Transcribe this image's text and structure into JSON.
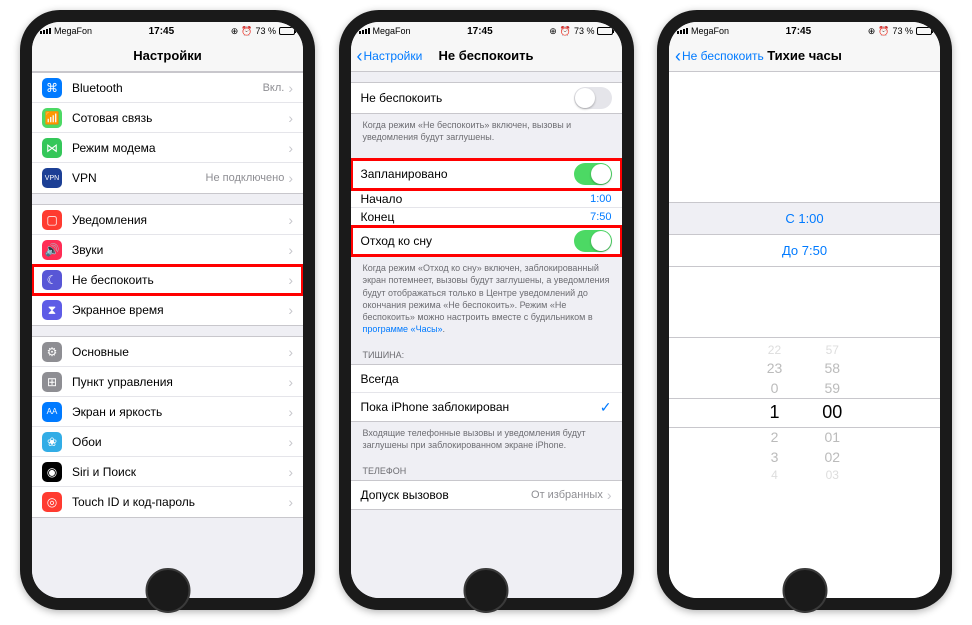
{
  "status": {
    "carrier": "MegaFon",
    "time": "17:45",
    "battery_pct": "73 %"
  },
  "phone1": {
    "title": "Настройки",
    "rows": {
      "bluetooth": "Bluetooth",
      "bluetooth_val": "Вкл.",
      "cellular": "Сотовая связь",
      "hotspot": "Режим модема",
      "vpn": "VPN",
      "vpn_val": "Не подключено",
      "notifications": "Уведомления",
      "sounds": "Звуки",
      "dnd": "Не беспокоить",
      "screentime": "Экранное время",
      "general": "Основные",
      "control": "Пункт управления",
      "display": "Экран и яркость",
      "wallpaper": "Обои",
      "siri": "Siri и Поиск",
      "touchid": "Touch ID и код-пароль"
    }
  },
  "phone2": {
    "back": "Настройки",
    "title": "Не беспокоить",
    "dnd_label": "Не беспокоить",
    "dnd_footer": "Когда режим «Не беспокоить» включен, вызовы и уведомления будут заглушены.",
    "scheduled": "Запланировано",
    "start_label": "Начало",
    "start_val": "1:00",
    "end_label": "Конец",
    "end_val": "7:50",
    "bedtime": "Отход ко сну",
    "bedtime_footer_1": "Когда режим «Отход ко сну» включен, заблокированный экран потемнеет, вызовы будут заглушены, а уведомления будут отображаться только в Центре уведомлений до окончания режима «Не беспокоить». Режим «Не беспокоить» можно настроить вместе с будильником в ",
    "bedtime_footer_link": "программе «Часы»",
    "silence_header": "ТИШИНА:",
    "always": "Всегда",
    "while_locked": "Пока iPhone заблокирован",
    "silence_footer": "Входящие телефонные вызовы и уведомления будут заглушены при заблокированном экране iPhone.",
    "phone_header": "ТЕЛЕФОН",
    "allow_calls": "Допуск вызовов",
    "allow_calls_val": "От избранных"
  },
  "phone3": {
    "back": "Не беспокоить",
    "title": "Тихие часы",
    "from": "С 1:00",
    "to": "До 7:50",
    "picker": {
      "hours": [
        "22",
        "23",
        "0",
        "1",
        "2",
        "3",
        "4"
      ],
      "mins": [
        "57",
        "58",
        "59",
        "00",
        "01",
        "02",
        "03"
      ]
    }
  }
}
